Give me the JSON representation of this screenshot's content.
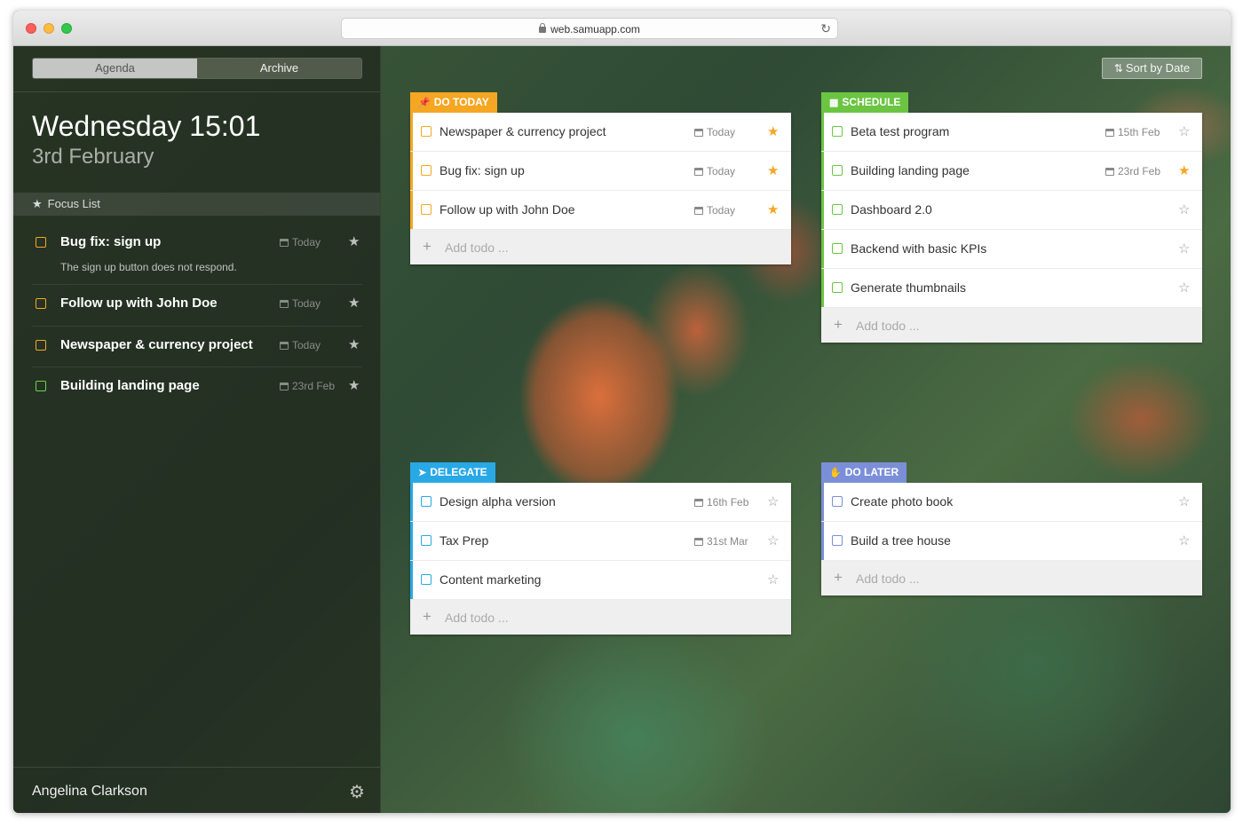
{
  "browser": {
    "url": "web.samuapp.com"
  },
  "sidebar": {
    "tabs": [
      {
        "label": "Agenda"
      },
      {
        "label": "Archive"
      }
    ],
    "day_time": "Wednesday 15:01",
    "date": "3rd February",
    "focus_header": "Focus List",
    "focus_items": [
      {
        "title": "Bug fix: sign up",
        "subtitle": "The sign up button does not respond.",
        "date": "Today",
        "color": "#f5a623"
      },
      {
        "title": "Follow up with John Doe",
        "date": "Today",
        "color": "#f5a623"
      },
      {
        "title": "Newspaper & currency project",
        "date": "Today",
        "color": "#f5a623"
      },
      {
        "title": "Building landing page",
        "date": "23rd Feb",
        "color": "#6bd34c"
      }
    ],
    "user_name": "Angelina Clarkson"
  },
  "toolbar": {
    "sort_label": "Sort by Date"
  },
  "add_todo_label": "Add todo ...",
  "panels": {
    "do_today": {
      "title": "DO TODAY",
      "color": "#f5a623",
      "icon": "pin-icon",
      "items": [
        {
          "title": "Newspaper & currency project",
          "date": "Today",
          "starred": true
        },
        {
          "title": "Bug fix: sign up",
          "date": "Today",
          "starred": true
        },
        {
          "title": "Follow up with John Doe",
          "date": "Today",
          "starred": true
        }
      ]
    },
    "schedule": {
      "title": "SCHEDULE",
      "color": "#6bc542",
      "icon": "calendar-icon",
      "items": [
        {
          "title": "Beta test program",
          "date": "15th Feb",
          "starred": false
        },
        {
          "title": "Building landing page",
          "date": "23rd Feb",
          "starred": true
        },
        {
          "title": "Dashboard 2.0",
          "date": "",
          "starred": false
        },
        {
          "title": "Backend with basic KPIs",
          "date": "",
          "starred": false
        },
        {
          "title": "Generate thumbnails",
          "date": "",
          "starred": false
        }
      ]
    },
    "delegate": {
      "title": "DELEGATE",
      "color": "#29a8e6",
      "icon": "paper-plane-icon",
      "items": [
        {
          "title": "Design alpha version",
          "date": "16th Feb",
          "starred": false
        },
        {
          "title": "Tax Prep",
          "date": "31st Mar",
          "starred": false
        },
        {
          "title": "Content marketing",
          "date": "",
          "starred": false
        }
      ]
    },
    "do_later": {
      "title": "DO LATER",
      "color": "#7b8fd8",
      "icon": "hand-icon",
      "items": [
        {
          "title": "Create photo book",
          "date": "",
          "starred": false
        },
        {
          "title": "Build a tree house",
          "date": "",
          "starred": false
        }
      ]
    }
  }
}
